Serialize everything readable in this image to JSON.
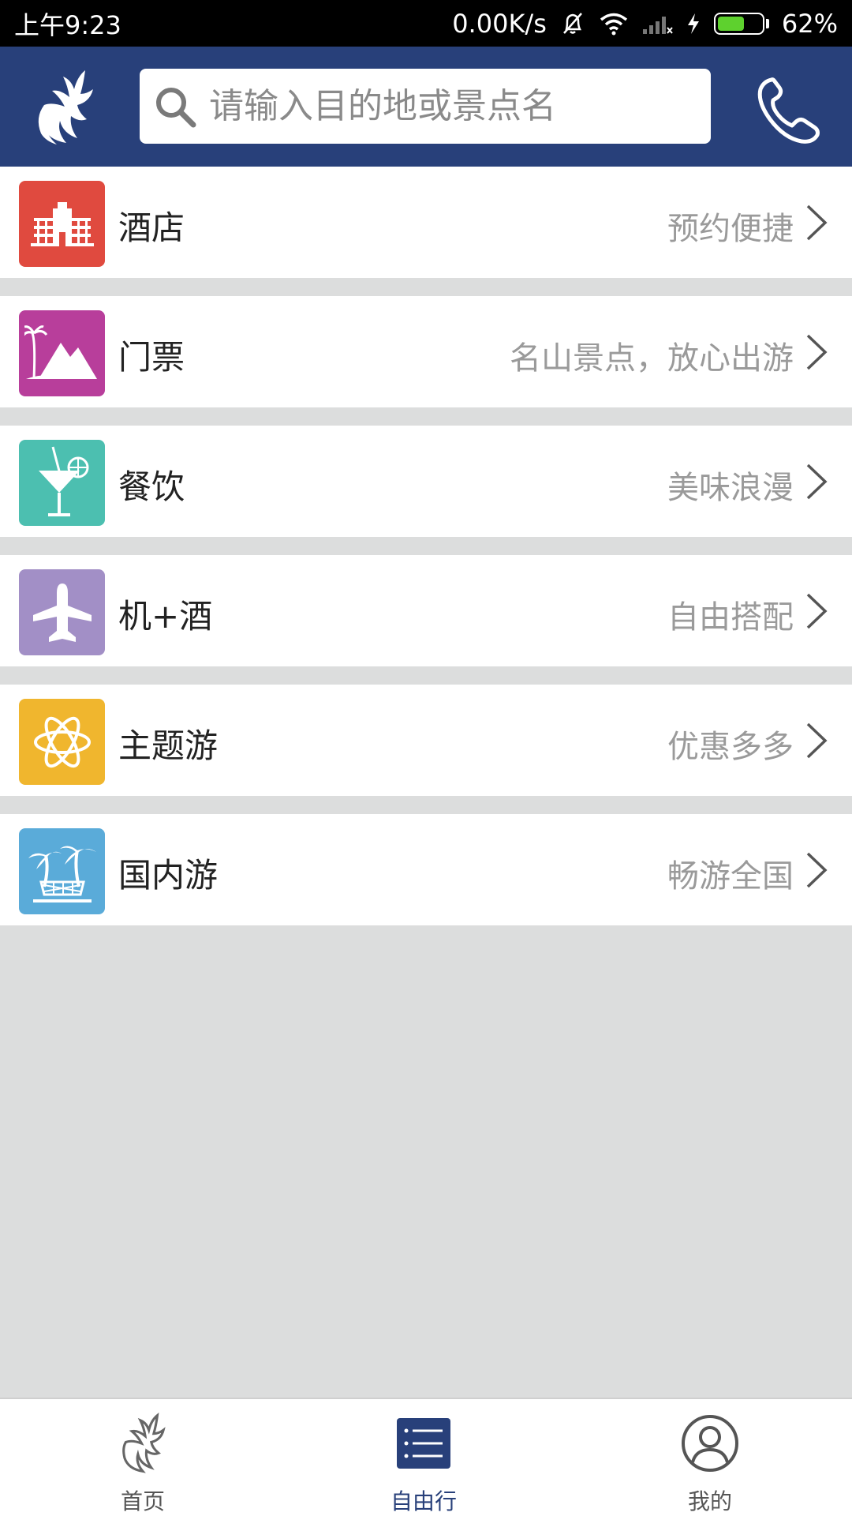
{
  "status_bar": {
    "time": "上午9:23",
    "speed": "0.00K/s",
    "battery": "62%",
    "battery_level": 0.62,
    "icons": [
      "bell-off-icon",
      "wifi-icon",
      "signal-icon",
      "charging-icon",
      "battery-icon"
    ]
  },
  "header": {
    "search_placeholder": "请输入目的地或景点名",
    "logo_icon": "bird-logo-icon",
    "phone_icon": "phone-icon"
  },
  "categories": [
    {
      "label": "酒店",
      "desc": "预约便捷",
      "icon": "hotel-icon",
      "color": "#e04a3f"
    },
    {
      "label": "门票",
      "desc": "名山景点，放心出游",
      "icon": "mountain-icon",
      "color": "#b83e9b"
    },
    {
      "label": "餐饮",
      "desc": "美味浪漫",
      "icon": "cocktail-icon",
      "color": "#4cbfb0"
    },
    {
      "label": "机+酒",
      "desc": "自由搭配",
      "icon": "airplane-icon",
      "color": "#a28fc6"
    },
    {
      "label": "主题游",
      "desc": "优惠多多",
      "icon": "atom-icon",
      "color": "#f0b62e"
    },
    {
      "label": "国内游",
      "desc": "畅游全国",
      "icon": "palm-tree-icon",
      "color": "#5aabd9"
    }
  ],
  "bottom_nav": {
    "items": [
      {
        "label": "首页",
        "icon": "bird-logo-icon",
        "active": false
      },
      {
        "label": "自由行",
        "icon": "list-icon",
        "active": true
      },
      {
        "label": "我的",
        "icon": "user-icon",
        "active": false
      }
    ]
  },
  "colors": {
    "header_bg": "#28407a",
    "page_bg": "#dcdddd",
    "active_tab": "#28407a"
  }
}
